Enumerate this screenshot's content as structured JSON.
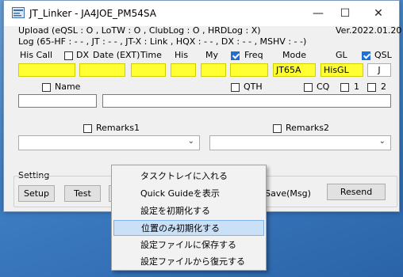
{
  "window": {
    "title": "JT_Linker - JA4JOE_PM54SA"
  },
  "status": {
    "upload_line": "Upload (eQSL : O , LoTW : O , ClubLog : O , HRDLog : X)",
    "version": "Ver.2022.01.20",
    "log_line": "Log (65-HF : - - , JT : - - , JT-X : Link , HQX : - - , DX : - - , MSHV : - -)"
  },
  "headers": {
    "his_call": "His Call",
    "dx": "DX",
    "date": "Date (EXT)",
    "time": "Time",
    "his": "His",
    "my": "My",
    "freq": "Freq",
    "mode": "Mode",
    "gl": "GL",
    "qsl": "QSL"
  },
  "checks": {
    "dx": false,
    "freq": true,
    "qsl": true,
    "name": false,
    "qth": false,
    "cq": false,
    "one": false,
    "two": false,
    "remarks1": false,
    "remarks2": false
  },
  "fields": {
    "mode_value": "JT65A",
    "gl_value": "HisGL",
    "j_value": "J"
  },
  "labels": {
    "name": "Name",
    "qth": "QTH",
    "cq": "CQ",
    "one": "1",
    "two": "2",
    "remarks1": "Remarks1",
    "remarks2": "Remarks2",
    "setting": "Setting"
  },
  "buttons": {
    "setup": "Setup",
    "test": "Test",
    "save_msg": "Save(Msg)",
    "resend": "Resend"
  },
  "context_menu": {
    "items": [
      {
        "label": "タスクトレイに入れる"
      },
      {
        "label": "Quick Guideを表示"
      },
      {
        "label": "設定を初期化する"
      },
      {
        "label": "位置のみ初期化する"
      },
      {
        "label": "設定ファイルに保存する"
      },
      {
        "label": "設定ファイルから復元する"
      }
    ],
    "highlighted_index": 3
  },
  "colors": {
    "field_yellow": "#ffff33",
    "checkbox_blue": "#1e6fd6",
    "menu_highlight": "#c9e0f7"
  }
}
